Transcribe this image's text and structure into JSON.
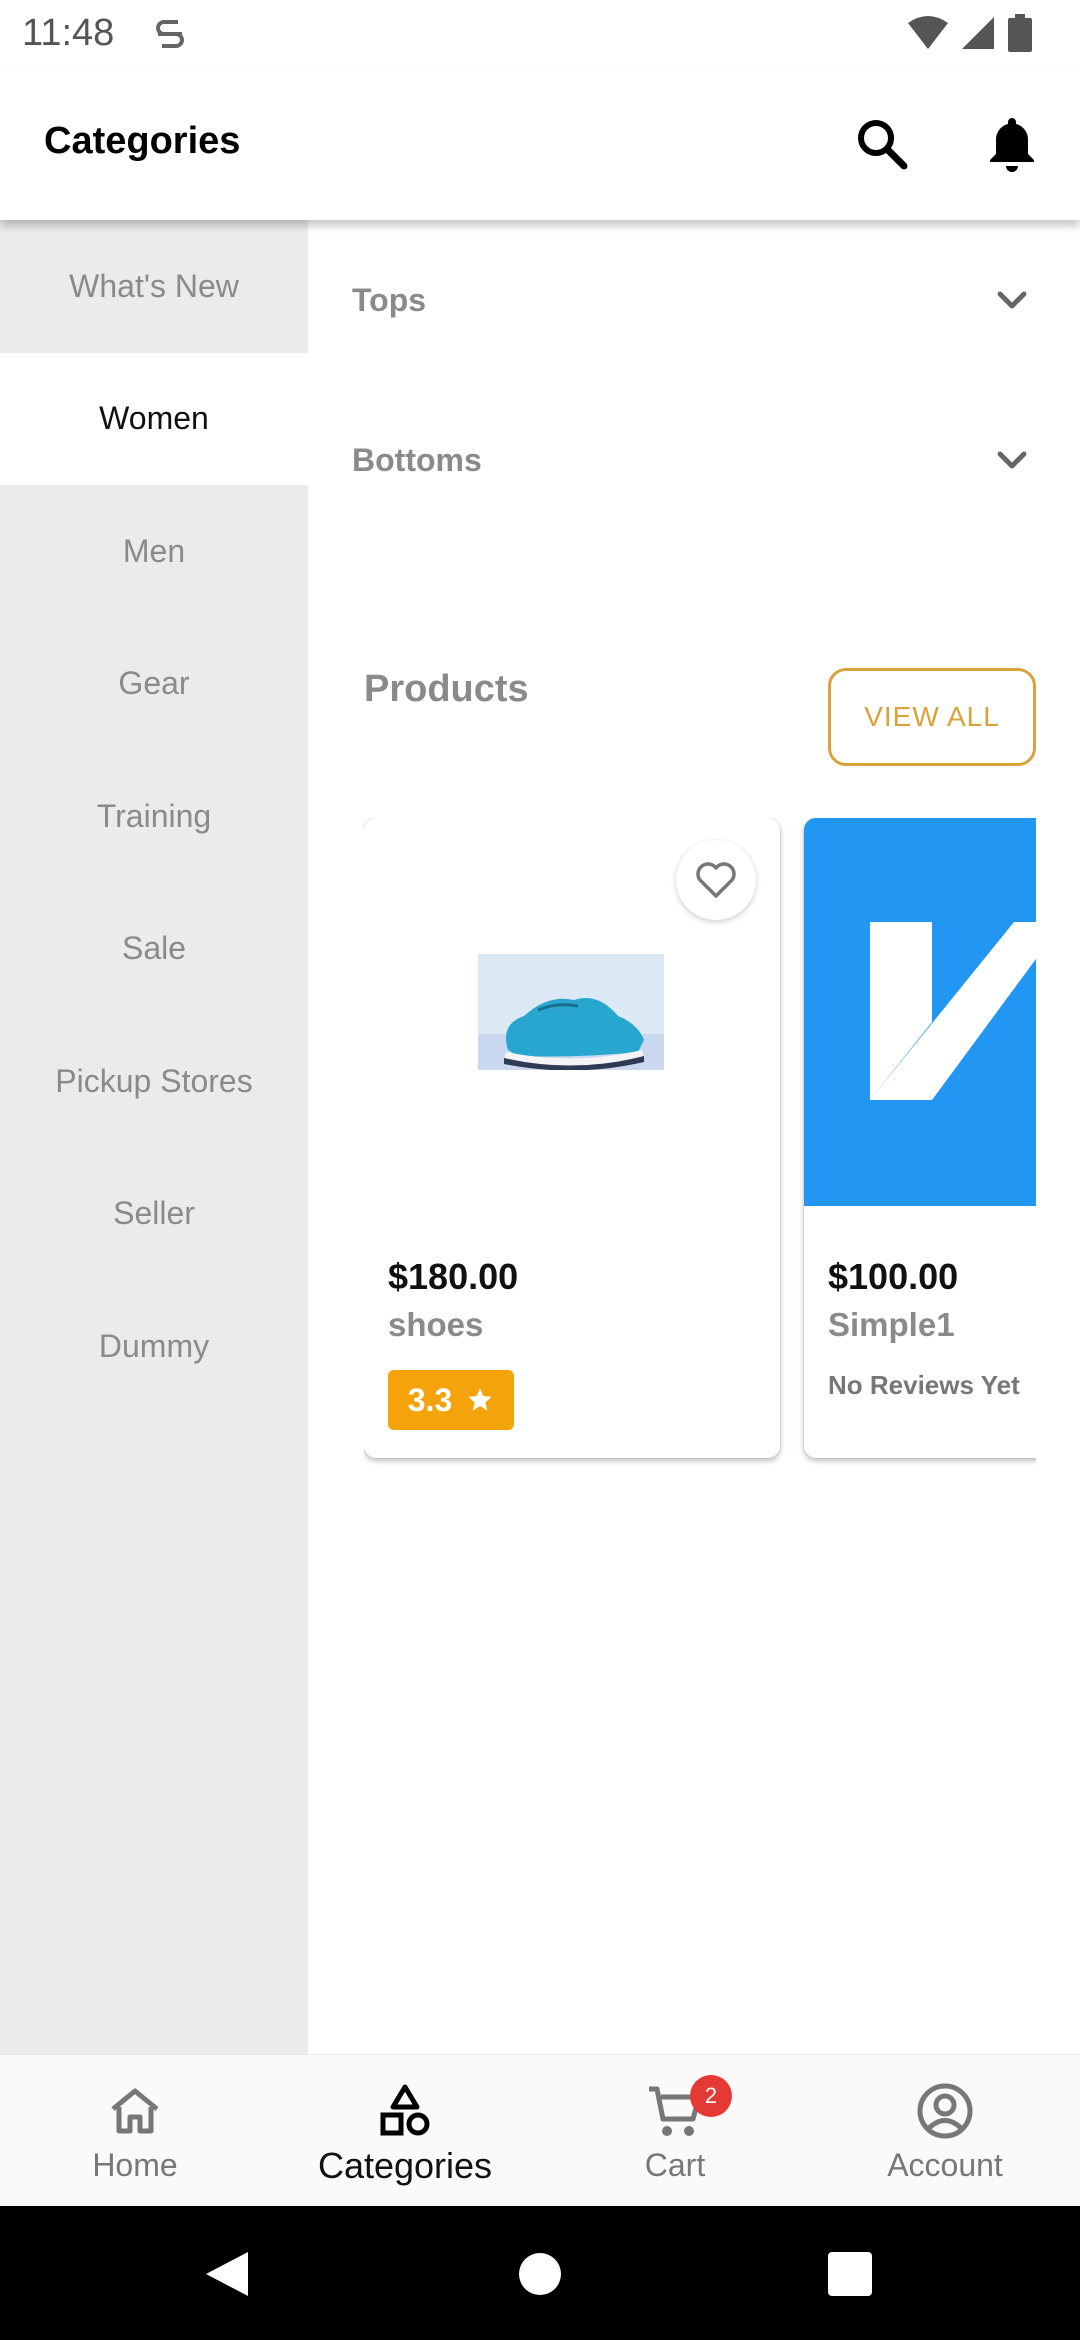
{
  "status_bar": {
    "time": "11:48"
  },
  "app_bar": {
    "title": "Categories"
  },
  "sidebar": {
    "items": [
      {
        "label": "What's New"
      },
      {
        "label": "Women"
      },
      {
        "label": "Men"
      },
      {
        "label": "Gear"
      },
      {
        "label": "Training"
      },
      {
        "label": "Sale"
      },
      {
        "label": "Pickup Stores"
      },
      {
        "label": "Seller"
      },
      {
        "label": "Dummy"
      }
    ],
    "active_index": 1
  },
  "subcategories": [
    {
      "label": "Tops"
    },
    {
      "label": "Bottoms"
    }
  ],
  "products_section": {
    "title": "Products",
    "view_all_label": "VIEW ALL"
  },
  "products": [
    {
      "price": "$180.00",
      "name": "shoes",
      "rating": "3.3"
    },
    {
      "price": "$100.00",
      "name": "Simple1",
      "reviews_text": "No Reviews Yet"
    }
  ],
  "bottom_nav": {
    "items": [
      {
        "label": "Home"
      },
      {
        "label": "Categories"
      },
      {
        "label": "Cart",
        "badge": "2"
      },
      {
        "label": "Account"
      }
    ],
    "active_index": 1
  },
  "colors": {
    "accent": "#d9a23b",
    "rating_bg": "#f5a30a",
    "badge": "#e53935",
    "sidebar_bg": "#ebebeb",
    "product2_bg": "#2196f3"
  }
}
